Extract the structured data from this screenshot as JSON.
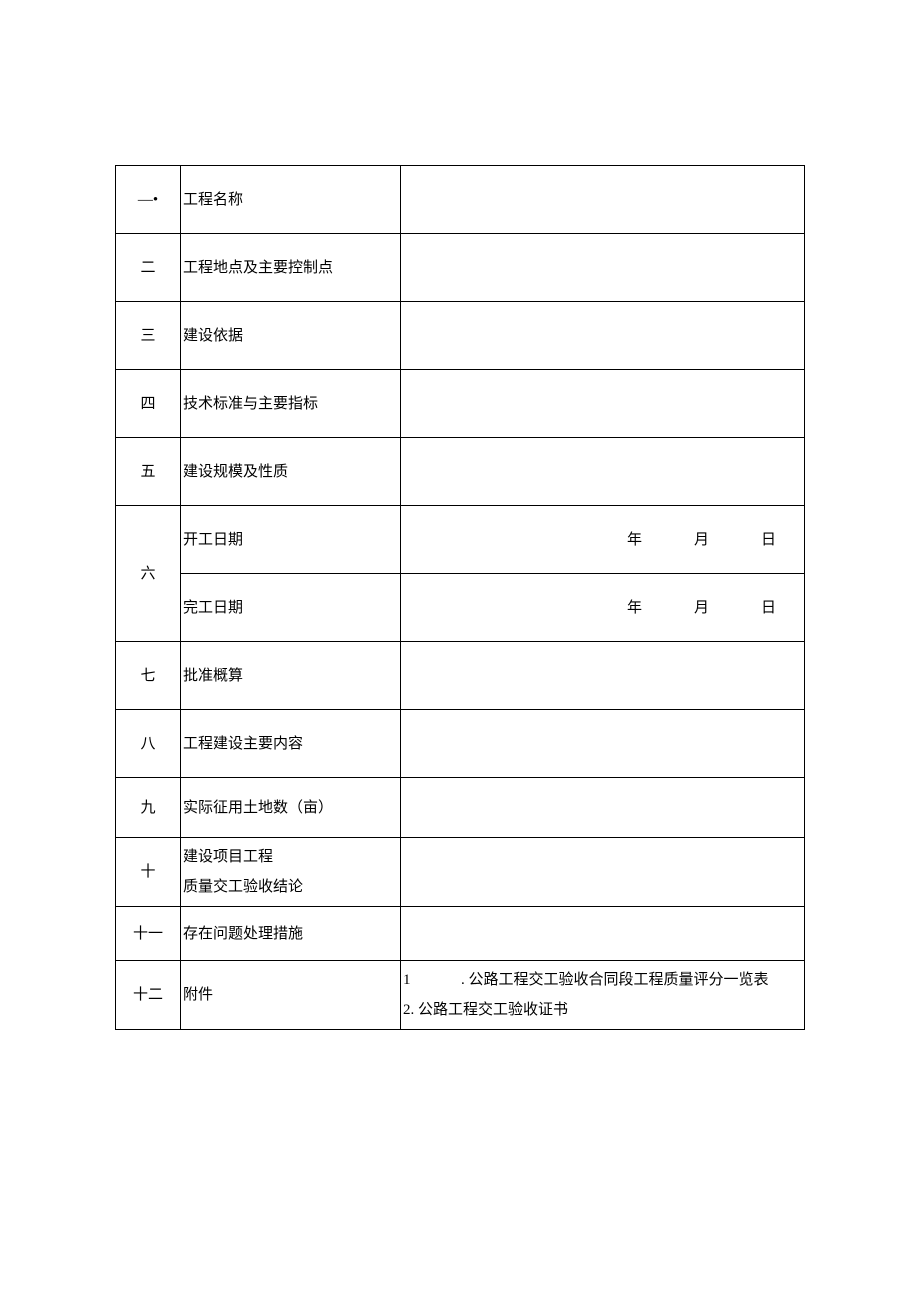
{
  "rows": {
    "r1": {
      "num": "—•",
      "label": "工程名称",
      "value": ""
    },
    "r2": {
      "num": "二",
      "label": "工程地点及主要控制点",
      "value": ""
    },
    "r3": {
      "num": "三",
      "label": "建设依据",
      "value": ""
    },
    "r4": {
      "num": "四",
      "label": "技术标准与主要指标",
      "value": ""
    },
    "r5": {
      "num": "五",
      "label": "建设规模及性质",
      "value": ""
    },
    "r6": {
      "num": "六",
      "start_label": "开工日期",
      "end_label": "完工日期",
      "date_y": "年",
      "date_m": "月",
      "date_d": "日"
    },
    "r7": {
      "num": "七",
      "label": "批准概算",
      "value": ""
    },
    "r8": {
      "num": "八",
      "label": "工程建设主要内容",
      "value": ""
    },
    "r9": {
      "num": "九",
      "label": "实际征用土地数（亩）",
      "value": ""
    },
    "r10": {
      "num": "十",
      "label_l1": "建设项目工程",
      "label_l2": "质量交工验收结论",
      "value": ""
    },
    "r11": {
      "num": "十一",
      "label": "存在问题处理措施",
      "value": ""
    },
    "r12": {
      "num": "十二",
      "label": "附件",
      "attach1_num": "1",
      "attach1_text": ". 公路工程交工验收合同段工程质量评分一览表",
      "attach2": "2. 公路工程交工验收证书"
    }
  }
}
